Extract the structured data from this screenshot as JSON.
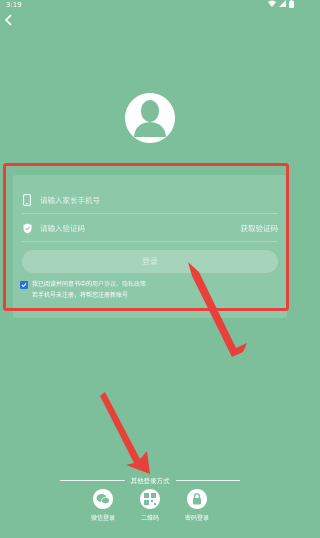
{
  "status_bar": {
    "time": "3:19"
  },
  "form": {
    "phone_placeholder": "请输入家长手机号",
    "code_placeholder": "请输入验证码",
    "get_code_label": "获取验证码",
    "login_label": "登录"
  },
  "agreement": {
    "prefix": "我已阅读并同意书中的",
    "links": "用户协议、隐私政策",
    "line2": "若手机号未注册，将帮您注册新账号",
    "checked": true
  },
  "other_login": {
    "title": "其他登录方式",
    "options": [
      {
        "label": "微信登录",
        "icon": "wechat-icon"
      },
      {
        "label": "二维码",
        "icon": "qrcode-icon"
      },
      {
        "label": "密码登录",
        "icon": "lock-icon"
      }
    ]
  },
  "colors": {
    "background": "#7dbf9b",
    "annotation": "#e8413c",
    "checkbox": "#2f6fd6"
  }
}
